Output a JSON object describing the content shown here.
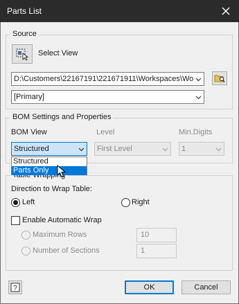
{
  "window": {
    "title": "Parts List"
  },
  "source": {
    "group_label": "Source",
    "select_view_label": "Select View",
    "path_value": "D:\\Customers\\22167191\\221671911\\Workspaces\\Wo",
    "view_rep_value": "[Primary]"
  },
  "bom": {
    "group_label": "BOM Settings and Properties",
    "bom_view_label": "BOM View",
    "bom_view_value": "Structured",
    "bom_view_options": [
      "Structured",
      "Parts Only"
    ],
    "highlighted_option": "Parts Only",
    "level_label": "Level",
    "level_value": "First Level",
    "min_digits_label": "Min.Digits",
    "min_digits_value": "1"
  },
  "wrapping": {
    "group_label": "Table Wrapping",
    "direction_label": "Direction to Wrap Table:",
    "left_label": "Left",
    "right_label": "Right",
    "selected_direction": "Left",
    "auto_wrap_label": "Enable Automatic Wrap",
    "auto_wrap_checked": false,
    "max_rows_label": "Maximum Rows",
    "max_rows_value": "10",
    "sections_label": "Number of Sections",
    "sections_value": "1"
  },
  "footer": {
    "ok_label": "OK",
    "cancel_label": "Cancel"
  },
  "icons": {
    "close": "close-icon",
    "select_view": "select-view-icon",
    "browse": "folder-browse-icon",
    "help": "help-icon",
    "cursor": "mouse-pointer-icon"
  }
}
